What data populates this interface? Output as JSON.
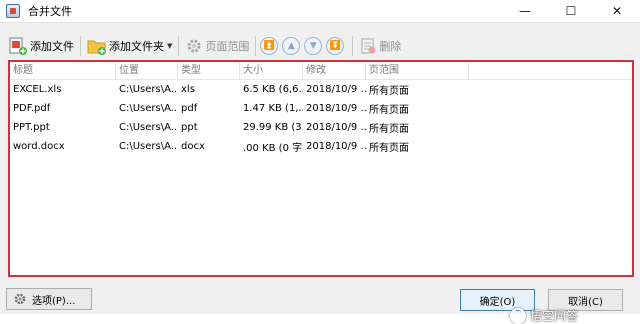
{
  "window": {
    "title": "合并文件",
    "minimize_glyph": "—",
    "maximize_glyph": "☐",
    "close_glyph": "✕"
  },
  "toolbar": {
    "add_file": "添加文件",
    "add_folder": "添加文件夹",
    "page_range": "页面范围",
    "delete": "删除"
  },
  "table": {
    "headers": [
      "标题",
      "位置",
      "类型",
      "大小",
      "修改",
      "页范围"
    ],
    "rows": [
      [
        "EXCEL.xls",
        "C:\\Users\\A...",
        "xls",
        "6.5 KB (6,6...",
        "2018/10/9 ...",
        "所有页面"
      ],
      [
        "PDF.pdf",
        "C:\\Users\\A...",
        "pdf",
        "1.47 KB (1,...",
        "2018/10/9 ...",
        "所有页面"
      ],
      [
        "PPT.ppt",
        "C:\\Users\\A...",
        "ppt",
        "29.99 KB (3...",
        "2018/10/9 ...",
        "所有页面"
      ],
      [
        "word.docx",
        "C:\\Users\\A...",
        "docx",
        ".00 KB (0 字...",
        "2018/10/9 ...",
        "所有页面"
      ]
    ]
  },
  "footer": {
    "options": "选项(P)...",
    "ok": "确定(O)",
    "cancel": "取消(C)"
  },
  "watermark": "悟空问答",
  "colors": {
    "highlight_border": "#c9353b",
    "dialog_bg": "#f0f0f0"
  }
}
